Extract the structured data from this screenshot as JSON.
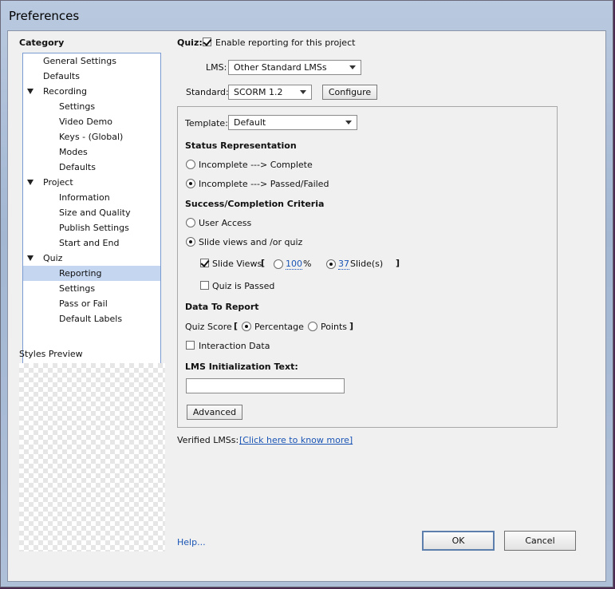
{
  "window": {
    "title": "Preferences"
  },
  "sidebar": {
    "category_label": "Category",
    "items": [
      {
        "label": "General Settings",
        "level": 1,
        "expander": false
      },
      {
        "label": "Defaults",
        "level": 1,
        "expander": false
      },
      {
        "label": "Recording",
        "level": 1,
        "expander": true
      },
      {
        "label": "Settings",
        "level": 2,
        "expander": false
      },
      {
        "label": "Video Demo",
        "level": 2,
        "expander": false
      },
      {
        "label": "Keys - (Global)",
        "level": 2,
        "expander": false
      },
      {
        "label": "Modes",
        "level": 2,
        "expander": false
      },
      {
        "label": "Defaults",
        "level": 2,
        "expander": false
      },
      {
        "label": "Project",
        "level": 1,
        "expander": true
      },
      {
        "label": "Information",
        "level": 2,
        "expander": false
      },
      {
        "label": "Size and Quality",
        "level": 2,
        "expander": false
      },
      {
        "label": "Publish Settings",
        "level": 2,
        "expander": false
      },
      {
        "label": "Start and End",
        "level": 2,
        "expander": false
      },
      {
        "label": "Quiz",
        "level": 1,
        "expander": true
      },
      {
        "label": "Reporting",
        "level": 2,
        "expander": false,
        "selected": true
      },
      {
        "label": "Settings",
        "level": 2,
        "expander": false
      },
      {
        "label": "Pass or Fail",
        "level": 2,
        "expander": false
      },
      {
        "label": "Default Labels",
        "level": 2,
        "expander": false
      }
    ],
    "styles_preview_label": "Styles Preview"
  },
  "quiz": {
    "label": "Quiz:",
    "enable_reporting_label": "Enable reporting for this project",
    "enable_reporting_checked": true
  },
  "lms": {
    "label": "LMS:",
    "value": "Other Standard LMSs"
  },
  "standard": {
    "label": "Standard:",
    "value": "SCORM 1.2",
    "configure_label": "Configure"
  },
  "template": {
    "label": "Template:",
    "value": "Default"
  },
  "status": {
    "heading": "Status Representation",
    "options": [
      {
        "label": "Incomplete ---> Complete",
        "selected": false
      },
      {
        "label": "Incomplete ---> Passed/Failed",
        "selected": true
      }
    ]
  },
  "criteria": {
    "heading": "Success/Completion Criteria",
    "user_access_label": "User Access",
    "user_access_selected": false,
    "slide_views_quiz_label": "Slide views and /or quiz",
    "slide_views_quiz_selected": true,
    "slide_views_label": "Slide Views",
    "slide_views_checked": true,
    "bracket_open": "[",
    "bracket_close": "]",
    "percent_value": "100",
    "percent_unit": "%",
    "percent_selected": false,
    "slides_value": "37",
    "slides_unit": "Slide(s)",
    "slides_selected": true,
    "quiz_passed_label": "Quiz is Passed",
    "quiz_passed_checked": false
  },
  "report": {
    "heading": "Data To Report",
    "quiz_score_label": "Quiz Score",
    "bracket_open": "[",
    "bracket_close": "]",
    "percentage_label": "Percentage",
    "percentage_selected": true,
    "points_label": "Points",
    "points_selected": false,
    "interaction_label": "Interaction Data",
    "interaction_checked": false
  },
  "lms_init": {
    "heading": "LMS Initialization Text:",
    "value": ""
  },
  "advanced_label": "Advanced",
  "verified": {
    "label": "Verified LMSs:",
    "link": "[Click here to know more]"
  },
  "footer": {
    "help_label": "Help...",
    "ok_label": "OK",
    "cancel_label": "Cancel"
  }
}
